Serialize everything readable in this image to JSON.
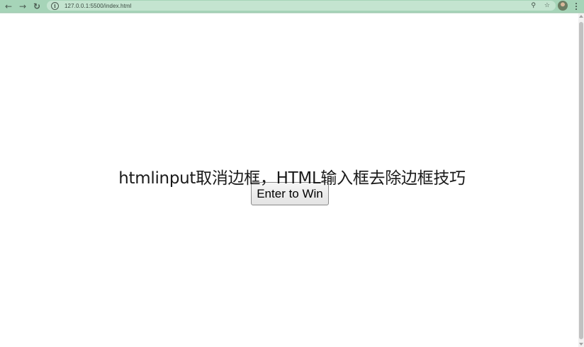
{
  "browser": {
    "back_icon": "back-arrow-icon",
    "forward_icon": "forward-arrow-icon",
    "reload_icon": "reload-icon",
    "url": "127.0.0.1:5500/index.html",
    "toolbar_color": "#a6d4b8"
  },
  "page": {
    "button_label": "Enter to Win",
    "headline": "htmlinput取消边框，HTML输入框去除边框技巧"
  }
}
